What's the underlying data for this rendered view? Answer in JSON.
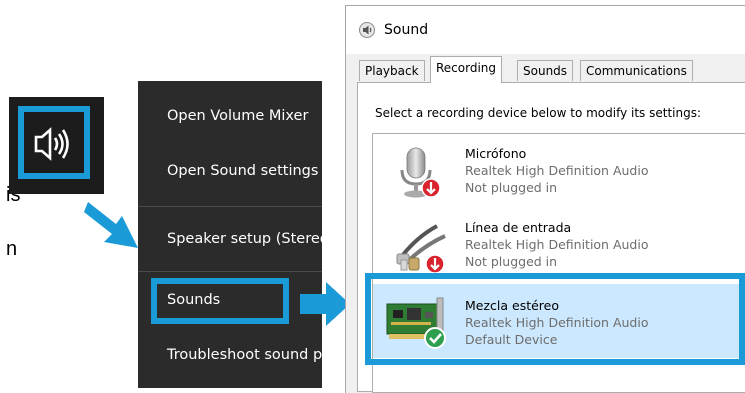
{
  "fragment": {
    "line1": "is",
    "line2": "n"
  },
  "context_menu": {
    "items": [
      {
        "label": "Open Volume Mixer"
      },
      {
        "label": "Open Sound settings"
      },
      {
        "label": "Speaker setup (Stereo)"
      },
      {
        "label": "Sounds"
      },
      {
        "label": "Troubleshoot sound problems"
      }
    ]
  },
  "dialog": {
    "title": "Sound",
    "tabs": [
      "Playback",
      "Recording",
      "Sounds",
      "Communications"
    ],
    "active_tab": "Recording",
    "instruction": "Select a recording device below to modify its settings:",
    "devices": [
      {
        "name": "Micrófono",
        "driver": "Realtek High Definition Audio",
        "status": "Not plugged in",
        "icon": "microphone-icon"
      },
      {
        "name": "Línea de entrada",
        "driver": "Realtek High Definition Audio",
        "status": "Not plugged in",
        "icon": "line-in-icon"
      },
      {
        "name": "Mezcla estéreo",
        "driver": "Realtek High Definition Audio",
        "status": "Default Device",
        "icon": "sound-card-icon"
      }
    ]
  },
  "colors": {
    "highlight": "#1a9ad6",
    "menu_bg": "#2b2b2b",
    "selected_row": "#cce8ff",
    "taskbar": "#1c1c1c"
  }
}
